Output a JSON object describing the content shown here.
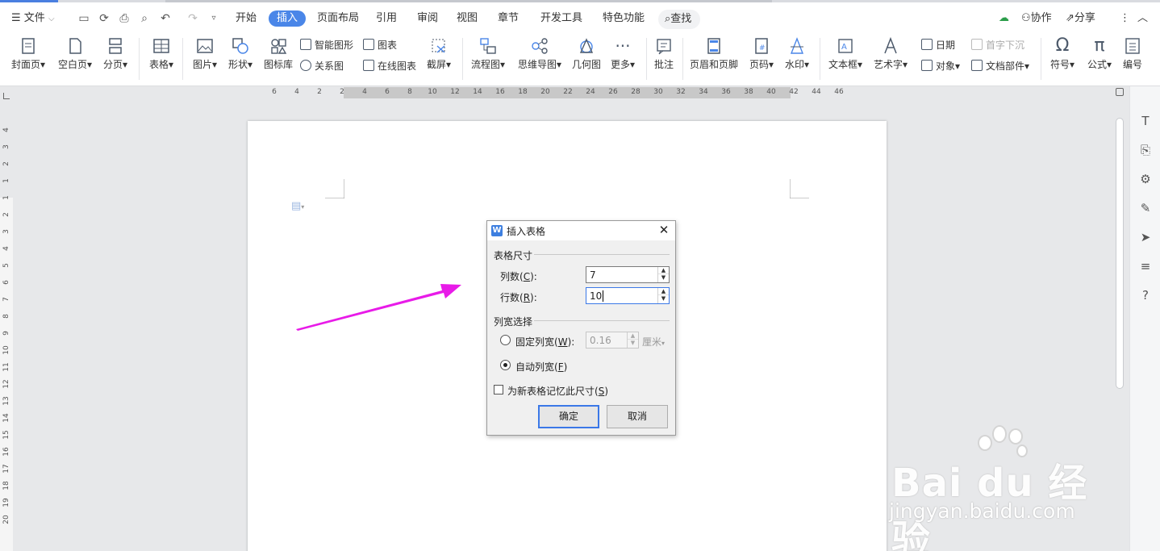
{
  "menubar": {
    "file_label": "文件",
    "tabs": [
      "开始",
      "插入",
      "页面布局",
      "引用",
      "审阅",
      "视图",
      "章节",
      "开发工具",
      "特色功能"
    ],
    "active_tab": "插入",
    "search_label": "查找",
    "collab_label": "协作",
    "share_label": "分享"
  },
  "ribbon": {
    "cover": "封面页",
    "blank": "空白页",
    "pagebreak": "分页",
    "table": "表格",
    "picture": "图片",
    "shape": "形状",
    "iconlib": "图标库",
    "smartart": "智能图形",
    "relation": "关系图",
    "chart": "图表",
    "onlinechart": "在线图表",
    "screenshot": "截屏",
    "flowchart": "流程图",
    "mindmap": "思维导图",
    "geometry": "几何图",
    "more": "更多",
    "comment": "批注",
    "headerfooter": "页眉和页脚",
    "pagenum": "页码",
    "watermark": "水印",
    "textbox": "文本框",
    "arttext": "艺术字",
    "date": "日期",
    "object": "对象",
    "dropcap": "首字下沉",
    "docparts": "文档部件",
    "symbol": "符号",
    "formula": "公式",
    "numbering": "编号"
  },
  "ruler": {
    "h_ticks": [
      "6",
      "4",
      "2",
      "2",
      "4",
      "6",
      "8",
      "10",
      "12",
      "14",
      "16",
      "18",
      "20",
      "22",
      "24",
      "26",
      "28",
      "30",
      "32",
      "34",
      "36",
      "38",
      "40",
      "42",
      "44",
      "46"
    ],
    "v_ticks": [
      "4",
      "3",
      "2",
      "1",
      "1",
      "2",
      "3",
      "4",
      "5",
      "6",
      "7",
      "8",
      "9",
      "10",
      "11",
      "12",
      "13",
      "14",
      "15",
      "16",
      "17",
      "18",
      "19",
      "20"
    ]
  },
  "dialog": {
    "title": "插入表格",
    "group_size": "表格尺寸",
    "cols_label": "列数(",
    "cols_key": "C",
    "cols_suffix": "):",
    "cols_value": "7",
    "rows_label": "行数(",
    "rows_key": "R",
    "rows_suffix": "):",
    "rows_value": "10",
    "group_width": "列宽选择",
    "fixed_label": "固定列宽(",
    "fixed_key": "W",
    "fixed_suffix": "):",
    "fixed_value": "0.16",
    "unit": "厘米",
    "auto_label": "自动列宽(",
    "auto_key": "F",
    "auto_suffix": ")",
    "remember_label": "为新表格记忆此尺寸(",
    "remember_key": "S",
    "remember_suffix": ")",
    "ok": "确定",
    "cancel": "取消"
  },
  "watermark": {
    "brand": "Bai du 经验",
    "url": "jingyan.baidu.com"
  },
  "colors": {
    "accent": "#4a86e8",
    "arrow": "#e81be8"
  }
}
